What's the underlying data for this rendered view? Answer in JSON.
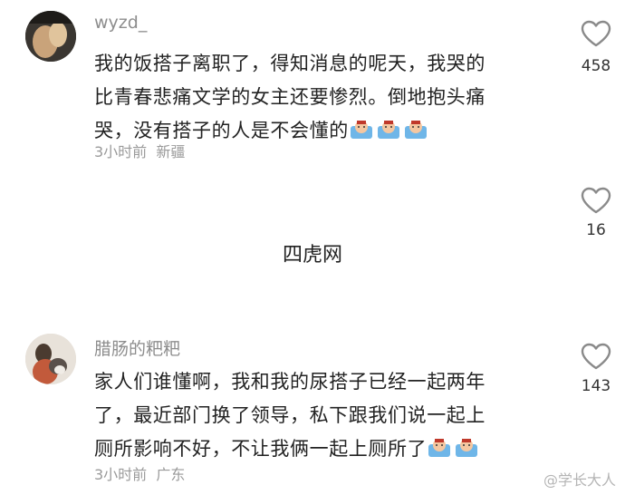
{
  "comments": [
    {
      "username": "wyzd_",
      "lines": [
        "我的饭搭子离职了，得知消息的呢天，我哭的",
        "比青春悲痛文学的女主还要惨烈。倒地抱头痛",
        "哭，没有搭子的人是不会懂的"
      ],
      "emoji": [
        "crying-face-emoji",
        "crying-face-emoji",
        "crying-face-emoji"
      ],
      "time": "3小时前",
      "location": "新疆",
      "likes": "458"
    },
    {
      "likes": "16"
    },
    {
      "username": "腊肠的粑粑",
      "lines": [
        "家人们谁懂啊，我和我的尿搭子已经一起两年",
        "了，最近部门换了领导，私下跟我们说一起上",
        "厕所影响不好，不让我俩一起上厕所了"
      ],
      "emoji": [
        "crying-face-emoji",
        "crying-face-emoji"
      ],
      "time": "3小时前",
      "location": "广东",
      "likes": "143"
    }
  ],
  "watermark_center": "四虎网",
  "watermark_corner": "@学长大人",
  "colors": {
    "heart": "#8a8a8a",
    "meta": "#9a9a9a",
    "username": "#8d8d8d"
  }
}
